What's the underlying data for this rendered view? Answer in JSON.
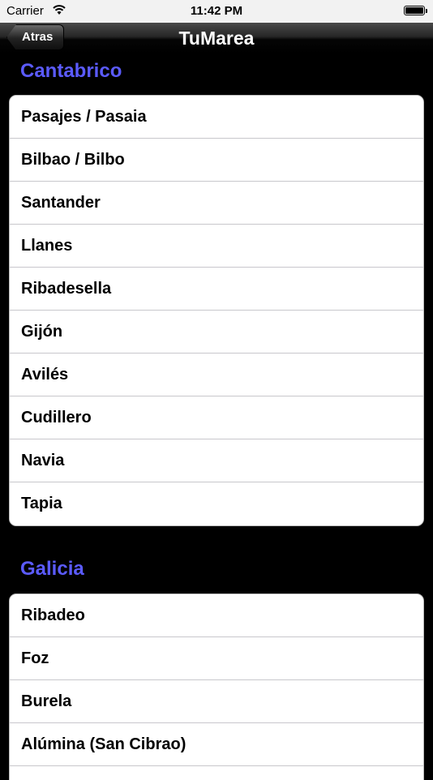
{
  "status_bar": {
    "carrier": "Carrier",
    "wifi_icon": "wifi-icon",
    "time": "11:42 PM",
    "battery_icon": "battery-icon"
  },
  "nav": {
    "back_label": "Atras",
    "title": "TuMarea"
  },
  "sections": [
    {
      "title": "Cantabrico",
      "items": [
        "Pasajes / Pasaia",
        "Bilbao / Bilbo",
        "Santander",
        "Llanes",
        "Ribadesella",
        "Gijón",
        "Avilés",
        "Cudillero",
        "Navia",
        "Tapia"
      ]
    },
    {
      "title": "Galicia",
      "items": [
        "Ribadeo",
        "Foz",
        "Burela",
        "Alúmina (San Cibrao)"
      ]
    }
  ],
  "colors": {
    "section_title": "#5b5bff",
    "background": "#000000"
  }
}
